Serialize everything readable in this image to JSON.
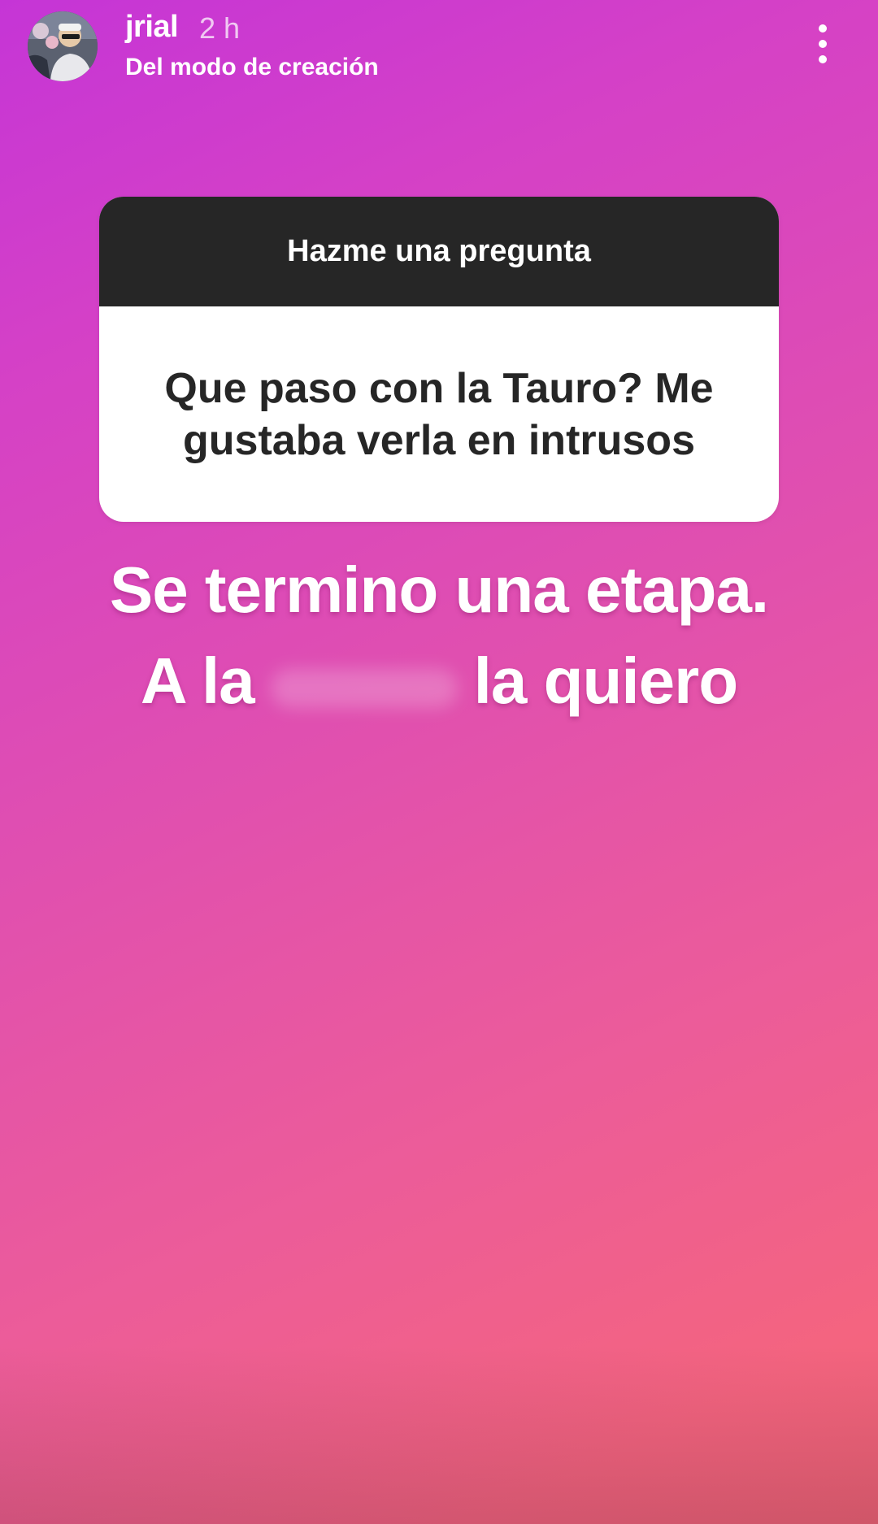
{
  "header": {
    "username": "jrial",
    "timestamp": "2 h",
    "subtitle": "Del modo de creación",
    "more_icon": "more-vertical-icon"
  },
  "question_sticker": {
    "title": "Hazme una pregunta",
    "question": "Que paso con la Tauro? Me gustaba verla en intrusos",
    "header_color": "#262626",
    "body_color": "#ffffff"
  },
  "answer": {
    "line1": "Se termino una etapa.",
    "line2_before": "A la",
    "line2_after": "la quiero"
  },
  "colors": {
    "gradient_start": "#c535d6",
    "gradient_end": "#f4647f",
    "text": "#ffffff"
  }
}
